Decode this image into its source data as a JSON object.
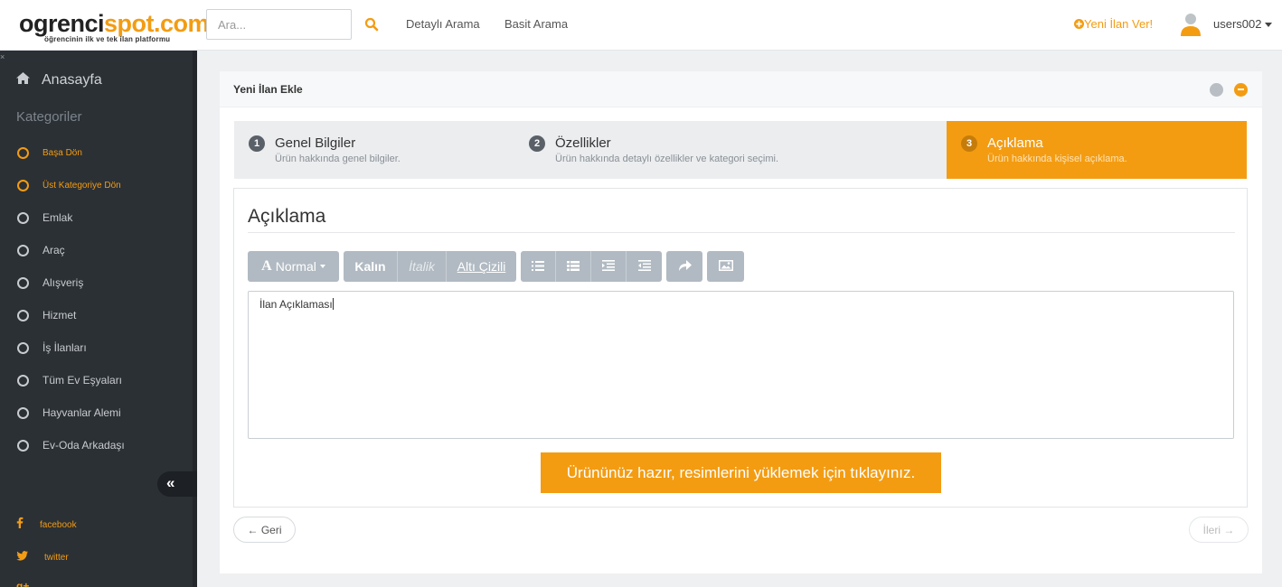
{
  "header": {
    "logo_part1": "ogrenci",
    "logo_part2": "spot.com",
    "logo_tagline": "öğrencinin ilk ve tek ilan platformu",
    "search_placeholder": "Ara...",
    "nav": [
      "Detaylı Arama",
      "Basit Arama"
    ],
    "new_listing": "Yeni İlan Ver!",
    "username": "users002"
  },
  "sidebar": {
    "home": "Anasayfa",
    "categories_heading": "Kategoriler",
    "items": [
      {
        "label": "Başa Dön",
        "highlight": true
      },
      {
        "label": "Üst Kategoriye Dön",
        "highlight": true
      },
      {
        "label": "Emlak"
      },
      {
        "label": "Araç"
      },
      {
        "label": "Alışveriş"
      },
      {
        "label": "Hizmet"
      },
      {
        "label": "İş İlanları"
      },
      {
        "label": "Tüm Ev Eşyaları"
      },
      {
        "label": "Hayvanlar Alemi"
      },
      {
        "label": "Ev-Oda Arkadaşı"
      }
    ],
    "social": [
      "facebook",
      "twitter"
    ]
  },
  "panel": {
    "title": "Yeni İlan Ekle",
    "steps": [
      {
        "num": "1",
        "title": "Genel Bilgiler",
        "desc": "Ürün hakkında genel bilgiler."
      },
      {
        "num": "2",
        "title": "Özellikler",
        "desc": "Ürün hakkında detaylı özellikler ve kategori seçimi."
      },
      {
        "num": "3",
        "title": "Açıklama",
        "desc": "Ürün hakkında kişisel açıklama."
      }
    ],
    "active_step": 3,
    "section_title": "Açıklama",
    "toolbar": {
      "style_label": "Normal",
      "bold": "Kalın",
      "italic": "İtalik",
      "underline": "Altı Çizili"
    },
    "editor_text": "İlan Açıklaması",
    "cta": "Ürününüz hazır, resimlerini yüklemek için tıklayınız.",
    "prev": "← Geri",
    "next": "İleri →"
  },
  "colors": {
    "accent": "#f39c12",
    "sidebar": "#2b3035",
    "toolbar": "#b1bac2"
  }
}
